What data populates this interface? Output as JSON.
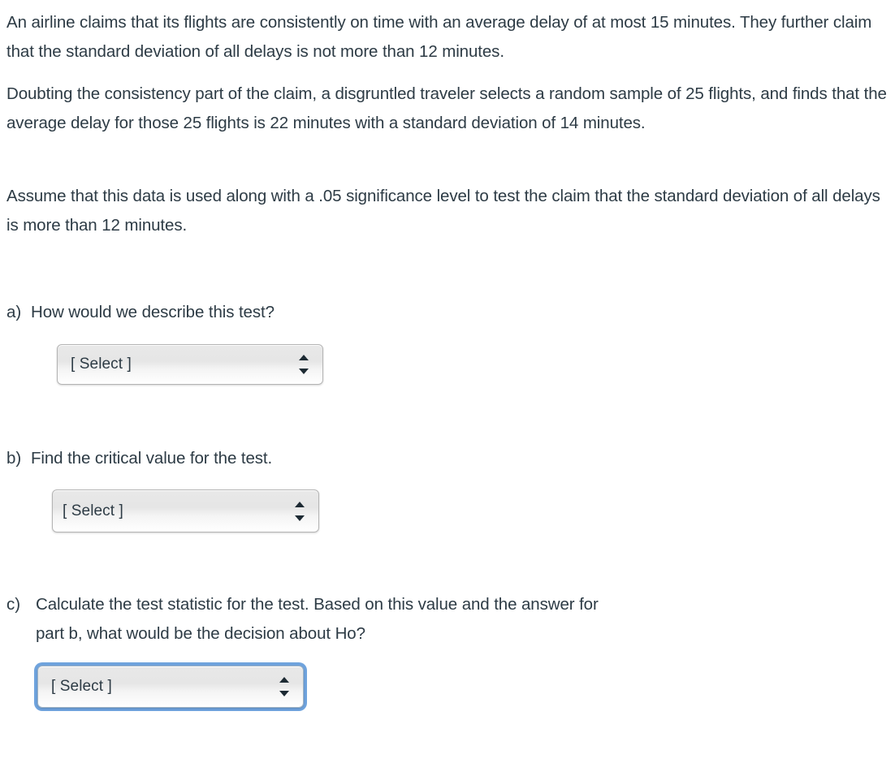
{
  "document": {
    "type": "homework-question",
    "background_color": "#ffffff",
    "text_color": "#2d3b45",
    "focus_ring_color": "#6fa3dd"
  },
  "paragraphs": [
    "An airline claims that its flights are consistently on time with an average delay of at most 15 minutes. They further claim that the standard deviation of all delays is not more than 12 minutes.",
    "Doubting the consistency part of the claim, a disgruntled traveler selects a random sample of 25 flights, and finds that the average delay for those 25 flights is 22 minutes with a standard deviation of 14 minutes.",
    "Assume that this data is used along with a .05 significance level to test the claim that the standard deviation of all delays is more than 12 minutes."
  ],
  "questions": [
    {
      "marker": "a)",
      "text": "How would we describe this test?",
      "select": {
        "value": "[ Select ]",
        "focused": false,
        "arrows_icon": "updown-triangles-icon"
      }
    },
    {
      "marker": "b)",
      "text": "Find the critical value for the test.",
      "select": {
        "value": "[ Select ]",
        "focused": false,
        "arrows_icon": "updown-triangles-icon"
      }
    },
    {
      "marker": "c)",
      "text": "Calculate the test statistic for the test.  Based on this value and the answer for part b, what would be the decision about Ho?",
      "select": {
        "value": "[ Select ]",
        "focused": true,
        "arrows_icon": "updown-triangles-icon"
      }
    }
  ]
}
